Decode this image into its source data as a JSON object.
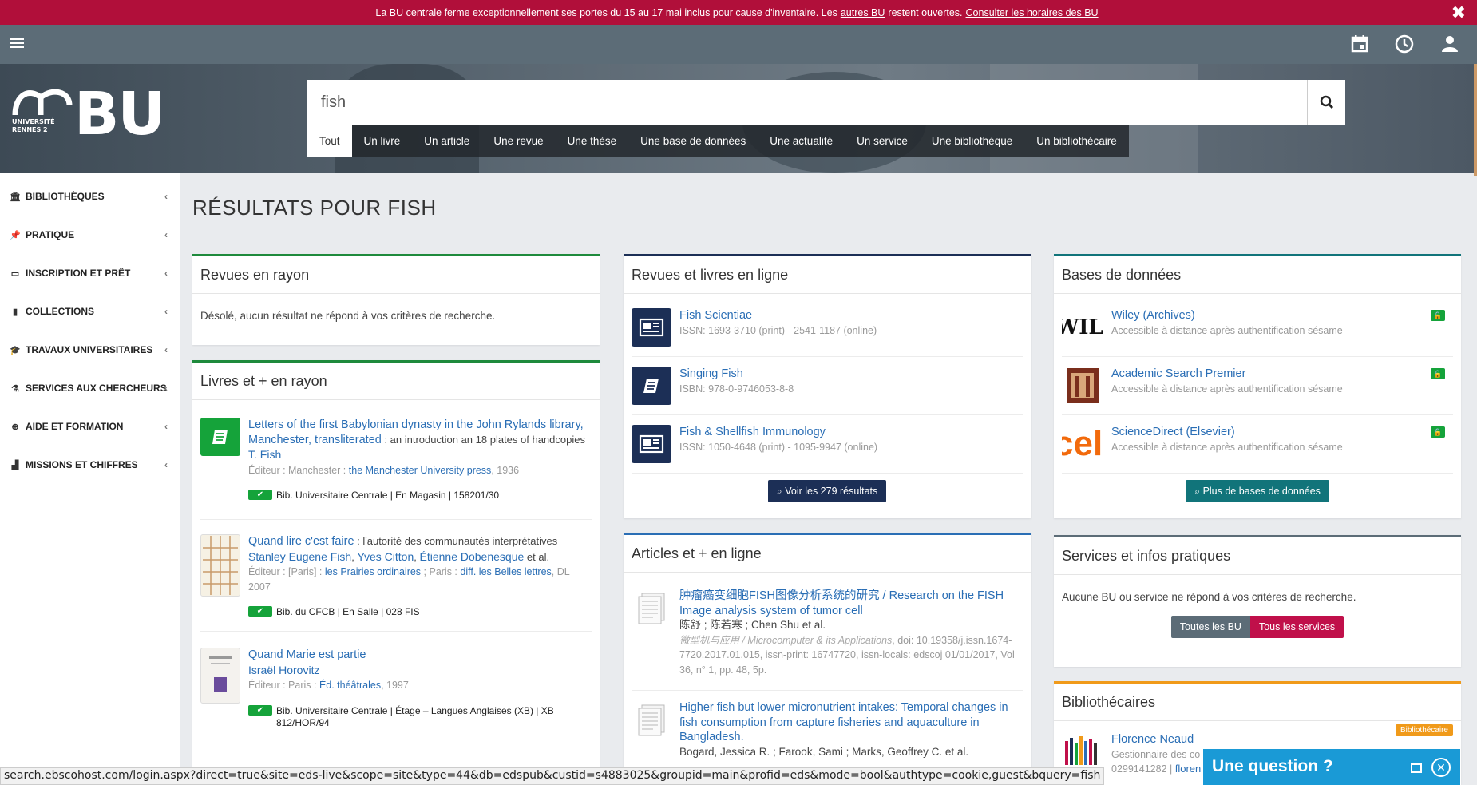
{
  "alert": {
    "text1": "La BU centrale ferme exceptionnellement ses portes du 15 au 17 mai inclus pour cause d'inventaire. Les",
    "link1": "autres BU",
    "text2": "restent ouvertes.",
    "link2": "Consulter les horaires des BU",
    "close": "✖"
  },
  "logo": {
    "univ_line1": "UNIVERSITÉ",
    "univ_line2": "RENNES 2",
    "bu": "BU"
  },
  "search": {
    "value": "fish",
    "placeholder": ""
  },
  "tabs": [
    "Tout",
    "Un livre",
    "Un article",
    "Une revue",
    "Une thèse",
    "Une base de données",
    "Une actualité",
    "Un service",
    "Une bibliothèque",
    "Un bibliothécaire"
  ],
  "sidebar": [
    {
      "label": "BIBLIOTHÈQUES",
      "icon": "bank-icon"
    },
    {
      "label": "PRATIQUE",
      "icon": "pin-icon"
    },
    {
      "label": "INSCRIPTION ET PRÊT",
      "icon": "card-icon"
    },
    {
      "label": "COLLECTIONS",
      "icon": "book-icon"
    },
    {
      "label": "TRAVAUX UNIVERSITAIRES",
      "icon": "graduation-icon"
    },
    {
      "label": "SERVICES AUX CHERCHEURS",
      "icon": "flask-icon"
    },
    {
      "label": "AIDE ET FORMATION",
      "icon": "lifebuoy-icon"
    },
    {
      "label": "MISSIONS ET CHIFFRES",
      "icon": "chart-icon"
    }
  ],
  "main_title": "RÉSULTATS POUR FISH",
  "revues_rayon": {
    "title": "Revues en rayon",
    "empty": "Désolé, aucun résultat ne répond à vos critères de recherche.",
    "color": "#1e8a3c"
  },
  "livres_rayon": {
    "title": "Livres et + en rayon",
    "color": "#1e8a3c",
    "items": [
      {
        "title": "Letters of the first Babylonian dynasty in the John Rylands library, Manchester, transliterated",
        "subtitle": " : an introduction an 18 plates of handcopies",
        "author": "T. Fish",
        "editeur_pre": "Éditeur : Manchester : ",
        "editeur_link": "the Manchester University press",
        "editeur_post": ", 1936",
        "holding": "Bib. Universitaire Centrale | En Magasin | 158201/30"
      },
      {
        "title": "Quand lire c'est faire",
        "subtitle": " : l'autorité des communautés interprétatives",
        "author": "Stanley Eugene Fish",
        "author2": "Yves Citton",
        "author3": "Étienne Dobenesque",
        "etal": " et al.",
        "editeur_pre": "Éditeur : [Paris] : ",
        "editeur_link": "les Prairies ordinaires",
        "editeur_mid": " ; Paris : ",
        "editeur_link2": "diff. les Belles lettres",
        "editeur_post": ", DL 2007",
        "holding": "Bib. du CFCB | En Salle | 028 FIS"
      },
      {
        "title": "Quand Marie est partie",
        "author": "Israël Horovitz",
        "editeur_pre": "Éditeur : Paris : ",
        "editeur_link": "Éd. théâtrales",
        "editeur_post": ", 1997",
        "holding": "Bib. Universitaire Centrale | Étage – Langues Anglaises (XB) | XB 812/HOR/94"
      }
    ]
  },
  "revues_ligne": {
    "title": "Revues et livres en ligne",
    "color": "#1c2f56",
    "items": [
      {
        "title": "Fish Scientiae",
        "meta": "ISSN: 1693-3710 (print) - 2541-1187 (online)",
        "icon": "newspaper-icon"
      },
      {
        "title": "Singing Fish",
        "meta": "ISBN: 978-0-9746053-8-8",
        "icon": "book-icon"
      },
      {
        "title": "Fish & Shellfish Immunology",
        "meta": "ISSN: 1050-4648 (print) - 1095-9947 (online)",
        "icon": "newspaper-icon"
      }
    ],
    "button": "Voir les 279 résultats"
  },
  "articles_ligne": {
    "title": "Articles et + en ligne",
    "color": "#2a6eb5",
    "items": [
      {
        "title": "肿瘤癌变细胞FISH图像分析系统的研究 / Research on the FISH Image analysis system of tumor cell",
        "authors": "陈舒 ; 陈若寒 ; Chen Shu et al.",
        "source": "微型机与应用 / Microcomputer & its Applications",
        "meta": ", doi: 10.19358/j.issn.1674-7720.2017.01.015, issn-print: 16747720, issn-locals: edscoj 01/01/2017, Vol 36, n° 1, pp. 48, 5p."
      },
      {
        "title": "Higher fish but lower micronutrient intakes: Temporal changes in fish consumption from capture fisheries and aquaculture in Bangladesh.",
        "authors": "Bogard, Jessica R. ; Farook, Sami ; Marks, Geoffrey C. et al.",
        "source": "",
        "meta": ""
      }
    ]
  },
  "bases": {
    "title": "Bases de données",
    "color": "#11747a",
    "items": [
      {
        "title": "Wiley (Archives)",
        "meta": "Accessible à distance après authentification sésame",
        "logo": "WILE"
      },
      {
        "title": "Academic Search Premier",
        "meta": "Accessible à distance après authentification sésame",
        "logo": "column-icon"
      },
      {
        "title": "ScienceDirect (Elsevier)",
        "meta": "Accessible à distance après authentification sésame",
        "logo": "cel"
      }
    ],
    "button": "Plus de bases de données"
  },
  "services": {
    "title": "Services et infos pratiques",
    "color": "#5c6c77",
    "empty": "Aucune BU ou service ne répond à vos critères de recherche.",
    "btn1": "Toutes les BU",
    "btn2": "Tous les services"
  },
  "bibliothecaires": {
    "title": "Bibliothécaires",
    "color": "#f09a1a",
    "name": "Florence Neaud",
    "role": "Gestionnaire des co",
    "phone": "0299141282 | ",
    "email": "floren",
    "badge": "Bibliothécaire"
  },
  "status_url": "search.ebscohost.com/login.aspx?direct=true&site=eds-live&scope=site&type=44&db=edspub&custid=s4883025&groupid=main&profid=eds&mode=bool&authtype=cookie,guest&bquery=fish",
  "chat": {
    "title": "Une question ?"
  }
}
